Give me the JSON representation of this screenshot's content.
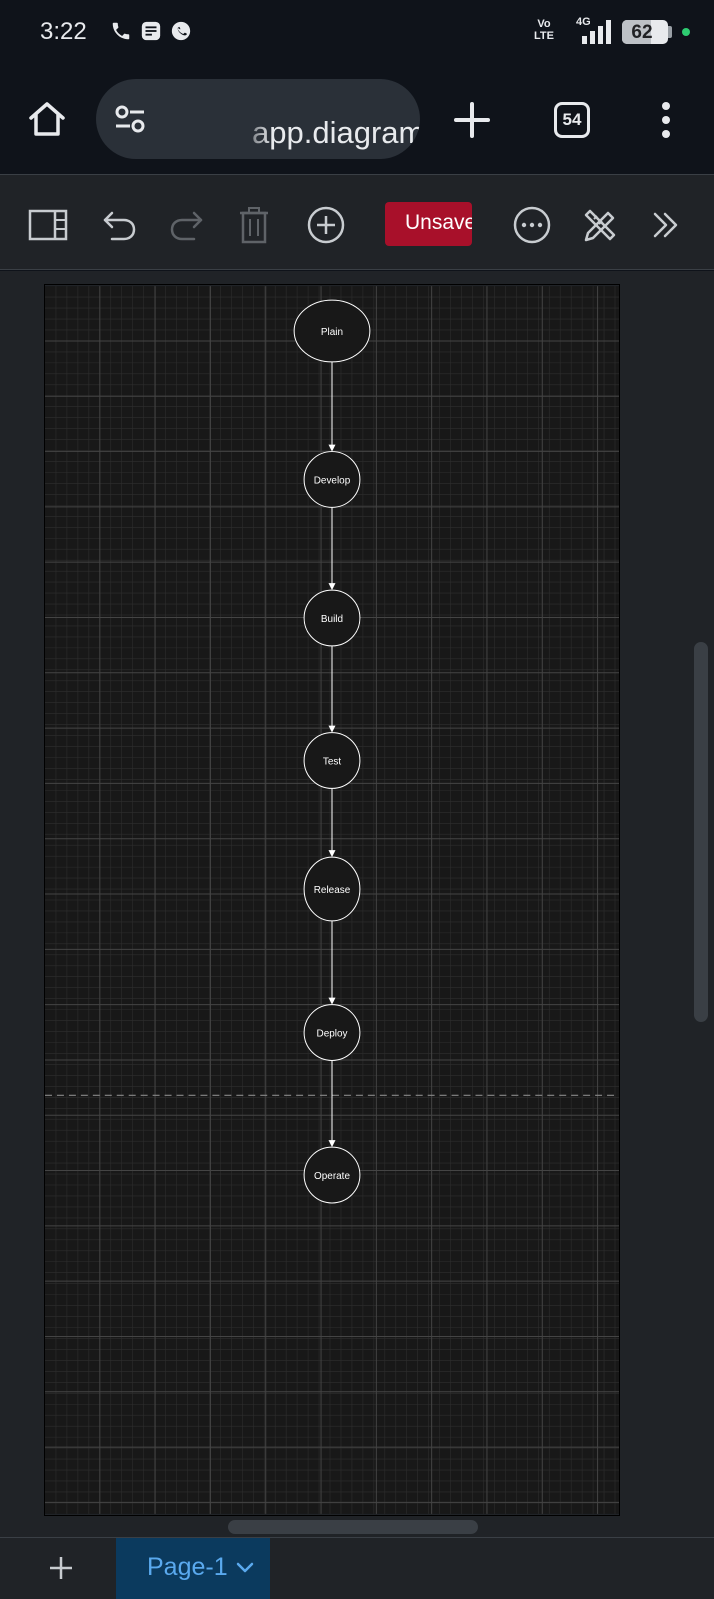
{
  "status_bar": {
    "time": "3:22",
    "network": "4G",
    "volte_line1": "Vo",
    "volte_line2": "LTE",
    "battery_percent": 62,
    "battery_text": "62"
  },
  "browser": {
    "url": "app.diagrams.net",
    "tab_count": "54",
    "icons": [
      "home-icon",
      "site-settings-icon",
      "new-tab-icon",
      "tab-switcher-icon",
      "more-vert-icon"
    ]
  },
  "toolbar": {
    "unsaved_label": "Unsaved",
    "unsaved_color": "#a8102a",
    "icons": [
      "format-panel-icon",
      "undo-icon",
      "redo-icon",
      "delete-icon",
      "insert-icon",
      "more-icon",
      "edit-style-icon",
      "expand-icon"
    ]
  },
  "diagram": {
    "background": "#181818",
    "grid_color": "#2e2e2e",
    "major_grid_color": "#444444",
    "node_stroke": "#ffffff",
    "nodes": [
      {
        "id": "plain",
        "label": "Plain"
      },
      {
        "id": "develop",
        "label": "Develop"
      },
      {
        "id": "build",
        "label": "Build"
      },
      {
        "id": "test",
        "label": "Test"
      },
      {
        "id": "release",
        "label": "Release"
      },
      {
        "id": "deploy",
        "label": "Deploy"
      },
      {
        "id": "operate",
        "label": "Operate"
      }
    ],
    "edges": [
      [
        "plain",
        "develop"
      ],
      [
        "develop",
        "build"
      ],
      [
        "build",
        "test"
      ],
      [
        "test",
        "release"
      ],
      [
        "release",
        "deploy"
      ],
      [
        "deploy",
        "operate"
      ]
    ]
  },
  "pages": {
    "active_label": "Page-1",
    "active_color": "#5aa9ee"
  }
}
